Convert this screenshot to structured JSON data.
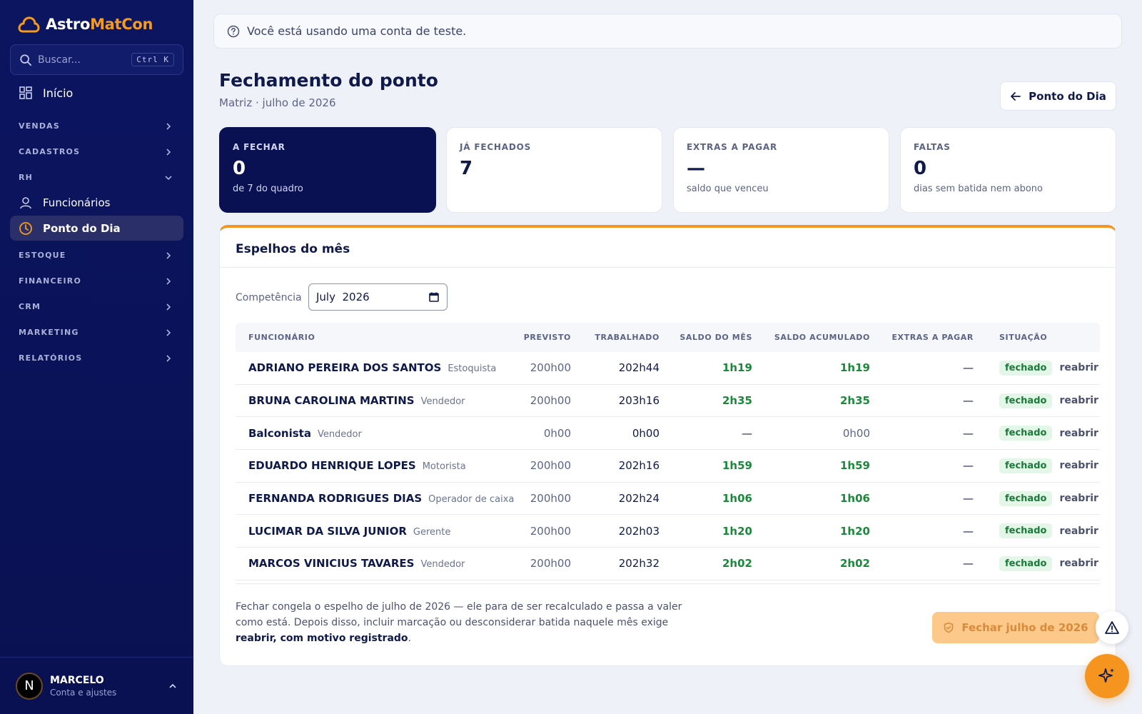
{
  "app": {
    "brand_part1": "Astro",
    "brand_part2": "MatCon"
  },
  "search": {
    "placeholder": "Buscar...",
    "shortcut": "Ctrl K"
  },
  "sidebar": {
    "home": "Início",
    "sections": [
      {
        "label": "VENDAS"
      },
      {
        "label": "CADASTROS"
      },
      {
        "label": "RH"
      },
      {
        "label": "ESTOQUE"
      },
      {
        "label": "FINANCEIRO"
      },
      {
        "label": "CRM"
      },
      {
        "label": "MARKETING"
      },
      {
        "label": "RELATÓRIOS"
      }
    ],
    "rh_items": [
      {
        "label": "Funcionários",
        "icon": "user-icon"
      },
      {
        "label": "Ponto do Dia",
        "icon": "clock-icon",
        "active": true
      }
    ]
  },
  "user": {
    "name": "MARCELO",
    "subtitle": "Conta e ajustes",
    "initial": "N"
  },
  "banner": {
    "text": "Você está usando uma conta de teste."
  },
  "header": {
    "title": "Fechamento do ponto",
    "subtitle": "Matriz · julho de 2026",
    "back_button": "Ponto do Dia"
  },
  "cards": [
    {
      "label": "A FECHAR",
      "value": "0",
      "note": "de 7 do quadro"
    },
    {
      "label": "JÁ FECHADOS",
      "value": "7",
      "note": ""
    },
    {
      "label": "EXTRAS A PAGAR",
      "value": "—",
      "note": "saldo que venceu"
    },
    {
      "label": "FALTAS",
      "value": "0",
      "note": "dias sem batida nem abono"
    }
  ],
  "panel": {
    "title": "Espelhos do mês",
    "competencia_label": "Competência",
    "competencia_value": "July  2026"
  },
  "table": {
    "headers": [
      "FUNCIONÁRIO",
      "PREVISTO",
      "TRABALHADO",
      "SALDO DO MÊS",
      "SALDO ACUMULADO",
      "EXTRAS A PAGAR",
      "SITUAÇÃO"
    ],
    "rows": [
      {
        "name": "ADRIANO PEREIRA DOS SANTOS",
        "role": "Estoquista",
        "previsto": "200h00",
        "trabalhado": "202h44",
        "saldo": "1h19",
        "acumulado": "1h19",
        "extras": "—",
        "situacao": "fechado",
        "action": "reabrir"
      },
      {
        "name": "BRUNA CAROLINA MARTINS",
        "role": "Vendedor",
        "previsto": "200h00",
        "trabalhado": "203h16",
        "saldo": "2h35",
        "acumulado": "2h35",
        "extras": "—",
        "situacao": "fechado",
        "action": "reabrir"
      },
      {
        "name": "Balconista",
        "role": "Vendedor",
        "previsto": "0h00",
        "trabalhado": "0h00",
        "saldo": "—",
        "acumulado": "0h00",
        "extras": "—",
        "situacao": "fechado",
        "action": "reabrir"
      },
      {
        "name": "EDUARDO HENRIQUE LOPES",
        "role": "Motorista",
        "previsto": "200h00",
        "trabalhado": "202h16",
        "saldo": "1h59",
        "acumulado": "1h59",
        "extras": "—",
        "situacao": "fechado",
        "action": "reabrir"
      },
      {
        "name": "FERNANDA RODRIGUES DIAS",
        "role": "Operador de caixa",
        "previsto": "200h00",
        "trabalhado": "202h24",
        "saldo": "1h06",
        "acumulado": "1h06",
        "extras": "—",
        "situacao": "fechado",
        "action": "reabrir"
      },
      {
        "name": "LUCIMAR DA SILVA JUNIOR",
        "role": "Gerente",
        "previsto": "200h00",
        "trabalhado": "202h03",
        "saldo": "1h20",
        "acumulado": "1h20",
        "extras": "—",
        "situacao": "fechado",
        "action": "reabrir"
      },
      {
        "name": "MARCOS VINICIUS TAVARES",
        "role": "Vendedor",
        "previsto": "200h00",
        "trabalhado": "202h32",
        "saldo": "2h02",
        "acumulado": "2h02",
        "extras": "—",
        "situacao": "fechado",
        "action": "reabrir"
      }
    ]
  },
  "footer": {
    "text_1": "Fechar congela o espelho de julho de 2026 — ele para de ser recalculado e passa a valer como está. Depois disso, incluir marcação ou desconsiderar batida naquele mês exige ",
    "text_bold": "reabrir, com motivo registrado",
    "text_2": ".",
    "close_button": "Fechar julho de 2026"
  },
  "colors": {
    "accent": "#f5941e",
    "navy": "#0a1152",
    "green": "#1a8a3a"
  }
}
